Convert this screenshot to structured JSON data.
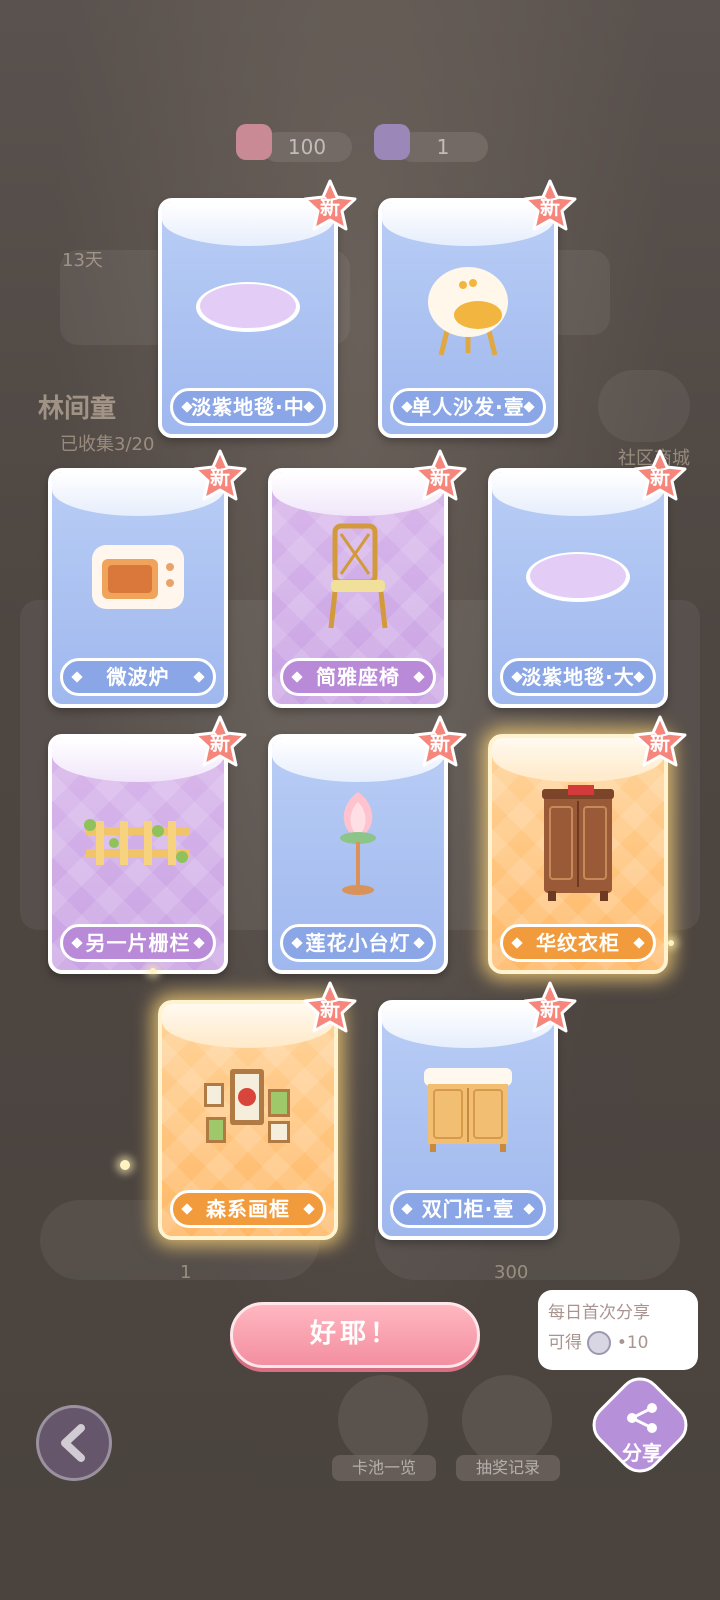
{
  "currency": {
    "hearts": "100",
    "tickets": "1"
  },
  "background": {
    "days_badge": "13天",
    "series_name": "林间童",
    "collected": "已收集3/20",
    "left_count": "1",
    "right_count": "300",
    "shop_label": "社区商城"
  },
  "badge_text": "新",
  "cards": [
    {
      "label": "淡紫地毯·中",
      "rarity": "blue",
      "icon": "rug-icon"
    },
    {
      "label": "单人沙发·壹",
      "rarity": "blue",
      "icon": "sofa-icon"
    },
    {
      "label": "微波炉",
      "rarity": "blue",
      "icon": "microwave-icon"
    },
    {
      "label": "简雅座椅",
      "rarity": "purple",
      "icon": "chair-icon"
    },
    {
      "label": "淡紫地毯·大",
      "rarity": "blue",
      "icon": "rug-icon"
    },
    {
      "label": "另一片栅栏",
      "rarity": "purple",
      "icon": "fence-icon"
    },
    {
      "label": "莲花小台灯",
      "rarity": "blue",
      "icon": "lotus-lamp-icon"
    },
    {
      "label": "华纹衣柜",
      "rarity": "gold",
      "icon": "wardrobe-icon"
    },
    {
      "label": "森系画框",
      "rarity": "gold",
      "icon": "picture-frames-icon"
    },
    {
      "label": "双门柜·壹",
      "rarity": "blue",
      "icon": "cabinet-icon"
    }
  ],
  "ok_button": "好耶！",
  "share": {
    "tip_line1": "每日首次分享",
    "tip_line2_prefix": "可得",
    "tip_reward": "•10",
    "label": "分享"
  },
  "bottom_nav": {
    "pool_overview": "卡池一览",
    "draw_record": "抽奖记录"
  },
  "colors": {
    "blue_card": "#a9c0f1",
    "purple_card": "#d0aee8",
    "gold_card": "#ffc67e",
    "badge": "#f6867c",
    "ok_button": "#f59fae"
  }
}
